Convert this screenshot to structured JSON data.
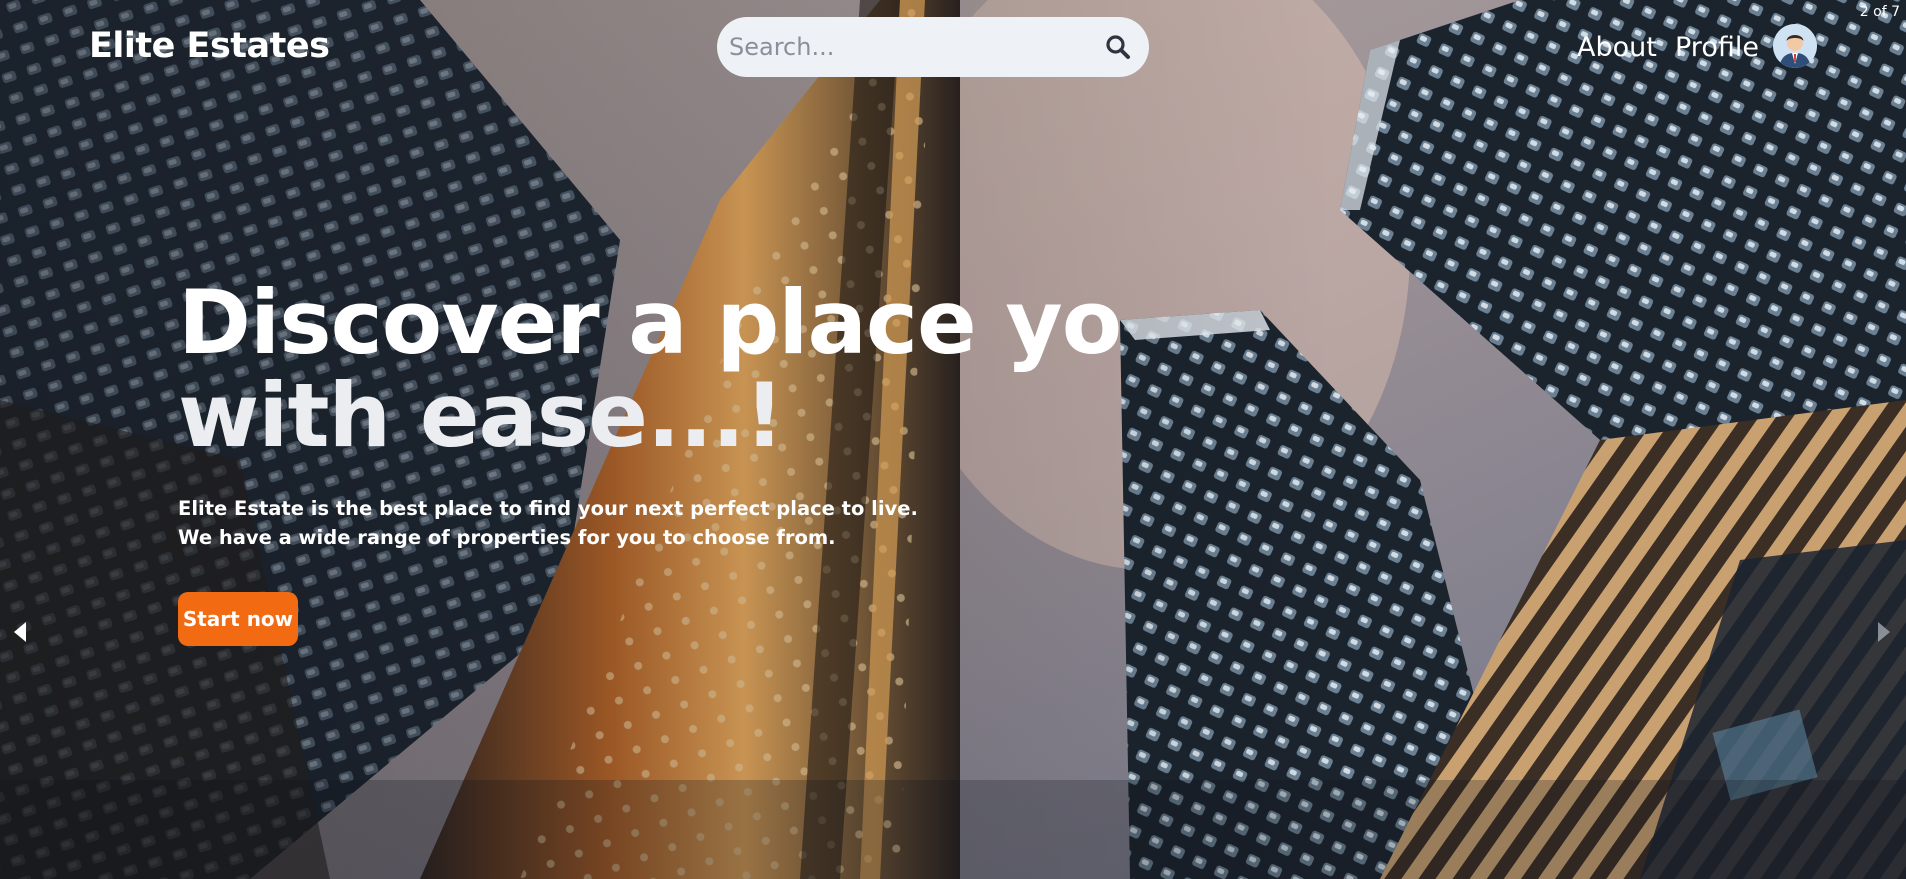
{
  "carousel": {
    "counter_text": "2 of 7",
    "prev_icon": "triangle-left-icon",
    "next_icon": "triangle-right-icon"
  },
  "nav": {
    "brand": "Elite Estates",
    "search_placeholder": "Search...",
    "search_icon": "magnifier-icon",
    "links": [
      "About",
      "Profile"
    ],
    "avatar_icon": "user-avatar-icon"
  },
  "hero": {
    "headline_line1": "Discover a place yo",
    "headline_line2": "with ease...!",
    "subtext_line1": "Elite Estate is the best place to find your next perfect place to live.",
    "subtext_line2": "We have a wide range of properties for you to choose from.",
    "cta_label": "Start now"
  },
  "colors": {
    "accent": "#f26b12",
    "search_bg": "#eef1f6",
    "text_light": "#ffffff"
  }
}
